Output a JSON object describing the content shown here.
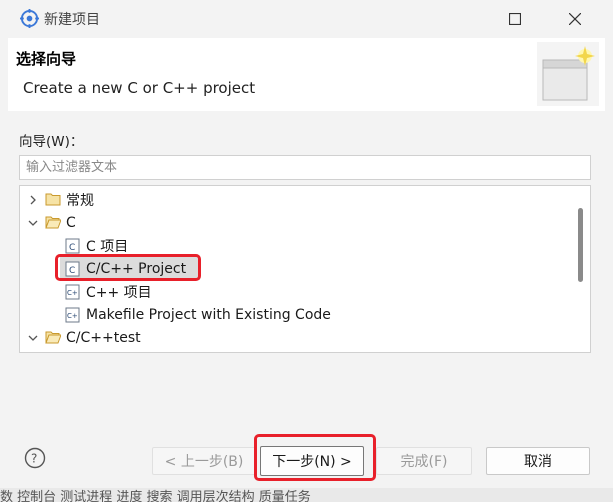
{
  "window": {
    "title": "新建项目"
  },
  "header": {
    "title": "选择向导",
    "description": "Create a new C or C++ project"
  },
  "wizard": {
    "label": "向导(W)：",
    "filter_placeholder": "输入过滤器文本",
    "tree": [
      {
        "label": "常规",
        "type": "folder",
        "expanded": false
      },
      {
        "label": "C",
        "type": "folder",
        "expanded": true
      },
      {
        "label": "C 项目",
        "type": "c-file"
      },
      {
        "label": "C/C++ Project",
        "type": "c-file",
        "selected": true
      },
      {
        "label": "C++ 项目",
        "type": "cpp-file"
      },
      {
        "label": "Makefile Project with Existing Code",
        "type": "cpp-file"
      },
      {
        "label": "C/C++test",
        "type": "folder",
        "expanded": true
      }
    ]
  },
  "buttons": {
    "back": "< 上一步(B)",
    "next": "下一步(N) >",
    "finish": "完成(F)",
    "cancel": "取消"
  },
  "footer": {
    "text": "数  控制台  测试进程  进度  搜索  调用层次结构  质量任务"
  },
  "colors": {
    "highlight": "#e8202a",
    "selection": "#dcdcdc",
    "accent": "#3b78d8"
  }
}
